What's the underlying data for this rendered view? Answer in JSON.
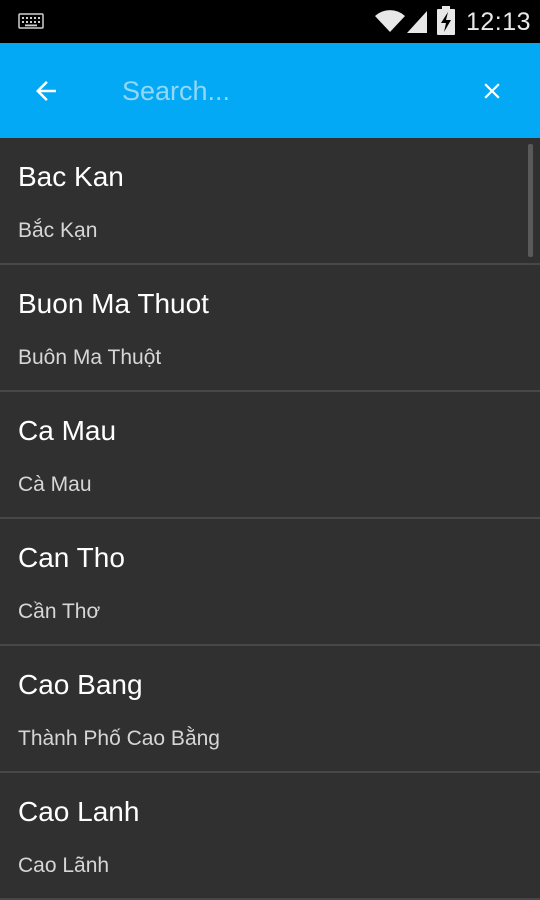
{
  "status_bar": {
    "time": "12:13",
    "icons": [
      "keyboard-icon",
      "wifi-icon",
      "cell-signal-icon",
      "battery-charging-icon"
    ]
  },
  "toolbar": {
    "back_icon": "arrow-left-icon",
    "clear_icon": "close-icon",
    "search": {
      "placeholder": "Search...",
      "value": ""
    }
  },
  "colors": {
    "toolbar": "#03a9f4",
    "background": "#303030",
    "divider": "#474747",
    "placeholder": "#93d7f7"
  },
  "list": {
    "items": [
      {
        "title": "Bac Kan",
        "subtitle": "Bắc Kạn"
      },
      {
        "title": "Buon Ma Thuot",
        "subtitle": "Buôn Ma Thuột"
      },
      {
        "title": "Ca Mau",
        "subtitle": "Cà Mau"
      },
      {
        "title": "Can Tho",
        "subtitle": "Cần Thơ"
      },
      {
        "title": "Cao Bang",
        "subtitle": "Thành Phố Cao Bằng"
      },
      {
        "title": "Cao Lanh",
        "subtitle": "Cao Lãnh"
      }
    ]
  }
}
